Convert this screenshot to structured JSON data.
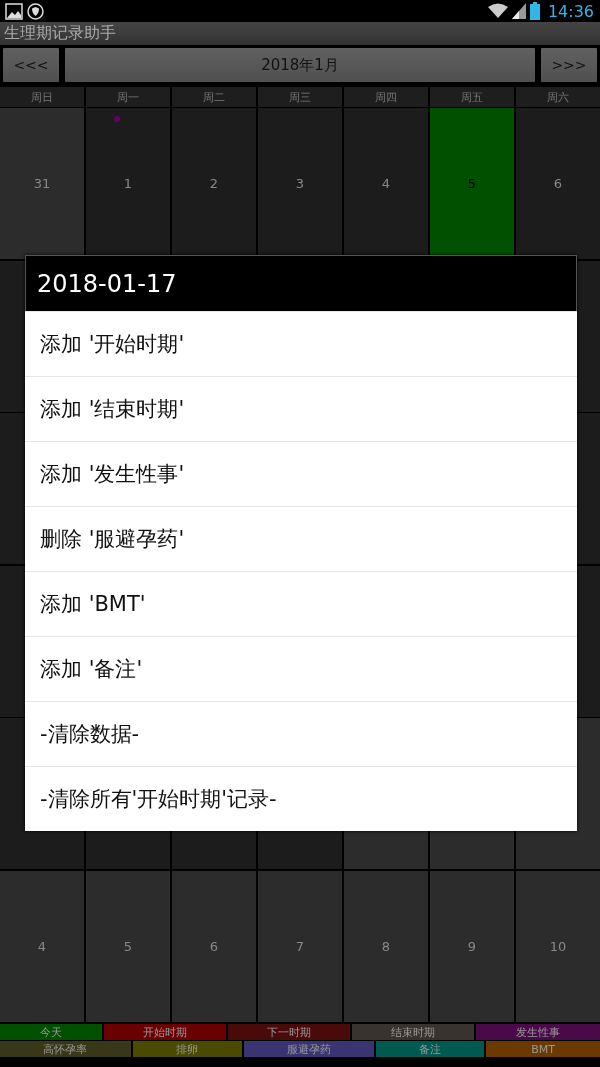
{
  "status_bar": {
    "time": "14:36"
  },
  "app_title": "生理期记录助手",
  "nav": {
    "prev": "<<<",
    "month": "2018年1月",
    "next": ">>>"
  },
  "weekdays": [
    "周日",
    "周一",
    "周二",
    "周三",
    "周四",
    "周五",
    "周六"
  ],
  "weeks": [
    [
      {
        "day": "31",
        "other_month": true,
        "today": false
      },
      {
        "day": "1",
        "other_month": false,
        "today": false,
        "color": "#660066"
      },
      {
        "day": "2",
        "other_month": false,
        "today": false
      },
      {
        "day": "3",
        "other_month": false,
        "today": false
      },
      {
        "day": "4",
        "other_month": false,
        "today": false
      },
      {
        "day": "5",
        "other_month": false,
        "today": true
      },
      {
        "day": "6",
        "other_month": false,
        "today": false
      }
    ],
    [
      {
        "other_month": false,
        "today": false
      },
      {
        "other_month": false,
        "today": false
      }
    ],
    [
      {
        "other_month": false,
        "today": false
      },
      {
        "other_month": false,
        "today": false
      }
    ],
    [
      {
        "other_month": false,
        "today": false
      },
      {
        "other_month": false,
        "today": false
      }
    ],
    [
      {
        "other_month": false,
        "today": false
      },
      {
        "other_month": false,
        "today": false
      },
      {
        "other_month": false,
        "today": false
      },
      {
        "other_month": false,
        "today": false
      },
      {
        "other_month": true,
        "today": false
      },
      {
        "other_month": true,
        "today": false
      },
      {
        "other_month": true,
        "today": false
      }
    ],
    [
      {
        "day": "4",
        "other_month": true,
        "today": false
      },
      {
        "day": "5",
        "other_month": true,
        "today": false
      },
      {
        "day": "6",
        "other_month": true,
        "today": false
      },
      {
        "day": "7",
        "other_month": true,
        "today": false
      },
      {
        "day": "8",
        "other_month": true,
        "today": false
      },
      {
        "day": "9",
        "other_month": true,
        "today": false
      },
      {
        "day": "10",
        "other_month": true,
        "today": false
      }
    ]
  ],
  "legend": [
    [
      {
        "label": "今天",
        "color": "#005000"
      },
      {
        "label": "开始时期",
        "color": "#6a0000"
      },
      {
        "label": "下一时期",
        "color": "#4a0a0a"
      },
      {
        "label": "结束时期",
        "color": "#38332e"
      },
      {
        "label": "发生性事",
        "color": "#4a0a4a"
      }
    ],
    [
      {
        "label": "高怀孕率",
        "color": "#383818"
      },
      {
        "label": "排卵",
        "color": "#4a4a00"
      },
      {
        "label": "服避孕药",
        "color": "#3a3570"
      },
      {
        "label": "备注",
        "color": "#005a50"
      },
      {
        "label": "BMT",
        "color": "#6a3a00"
      }
    ]
  ],
  "dialog": {
    "title": "2018-01-17",
    "items": [
      "添加 '开始时期'",
      "添加 '结束时期'",
      "添加 '发生性事'",
      "删除 '服避孕药'",
      "添加 'BMT'",
      "添加 '备注'",
      "-清除数据-",
      "-清除所有'开始时期'记录-"
    ]
  }
}
